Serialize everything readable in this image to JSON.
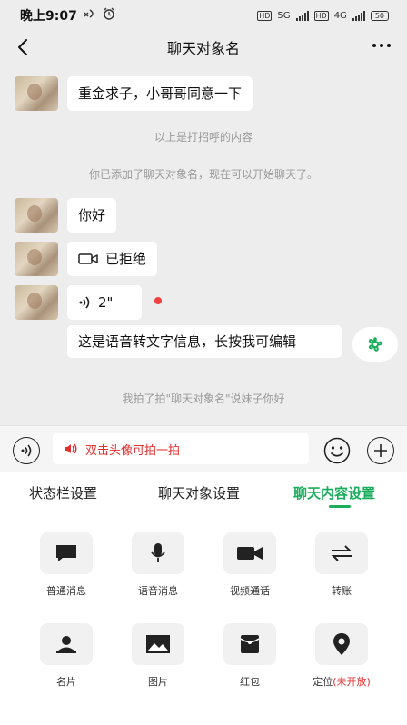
{
  "status_bar": {
    "time": "晚上9:07",
    "net1": "5G",
    "net2": "4G",
    "battery": "50"
  },
  "header": {
    "title": "聊天对象名"
  },
  "chat": {
    "messages": [
      {
        "text": "重金求子，小哥哥同意一下"
      },
      {
        "text": "你好"
      },
      {
        "text": "已拒绝"
      },
      {
        "text": "2\""
      }
    ],
    "notes": [
      "以上是打招呼的内容",
      "你已添加了聊天对象名，现在可以开始聊天了。",
      "我拍了拍\"聊天对象名\"说妹子你好"
    ],
    "stt_text": "这是语音转文字信息，长按我可编辑"
  },
  "input_bar": {
    "pat_hint": "双击头像可拍一拍"
  },
  "tabs": [
    {
      "label": "状态栏设置"
    },
    {
      "label": "聊天对象设置"
    },
    {
      "label": "聊天内容设置"
    }
  ],
  "grid": [
    {
      "label": "普通消息",
      "icon": "message-icon"
    },
    {
      "label": "语音消息",
      "icon": "microphone-icon"
    },
    {
      "label": "视频通话",
      "icon": "video-camera-icon"
    },
    {
      "label": "转账",
      "icon": "transfer-icon"
    },
    {
      "label": "名片",
      "icon": "contact-card-icon"
    },
    {
      "label": "图片",
      "icon": "image-icon"
    },
    {
      "label": "红包",
      "icon": "red-packet-icon"
    },
    {
      "label": "定位",
      "label_suffix": "(未开放)",
      "icon": "location-pin-icon"
    }
  ],
  "colors": {
    "accent": "#1aad5b",
    "chat_bg": "#ededed",
    "warning": "#e03030"
  }
}
